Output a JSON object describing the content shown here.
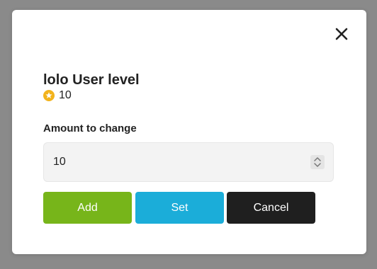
{
  "dialog": {
    "title": "lolo User level",
    "level_value": "10",
    "amount_label": "Amount to change",
    "amount_value": "10",
    "icons": {
      "close": "close-icon",
      "level": "star-icon",
      "spinner": "spinner-arrows-icon"
    },
    "buttons": {
      "add_label": "Add",
      "set_label": "Set",
      "cancel_label": "Cancel"
    },
    "colors": {
      "add": "#77b51a",
      "set": "#1badd9",
      "cancel": "#1f1f1f",
      "star": "#f2b31c",
      "backdrop": "#8a8a8a"
    }
  }
}
